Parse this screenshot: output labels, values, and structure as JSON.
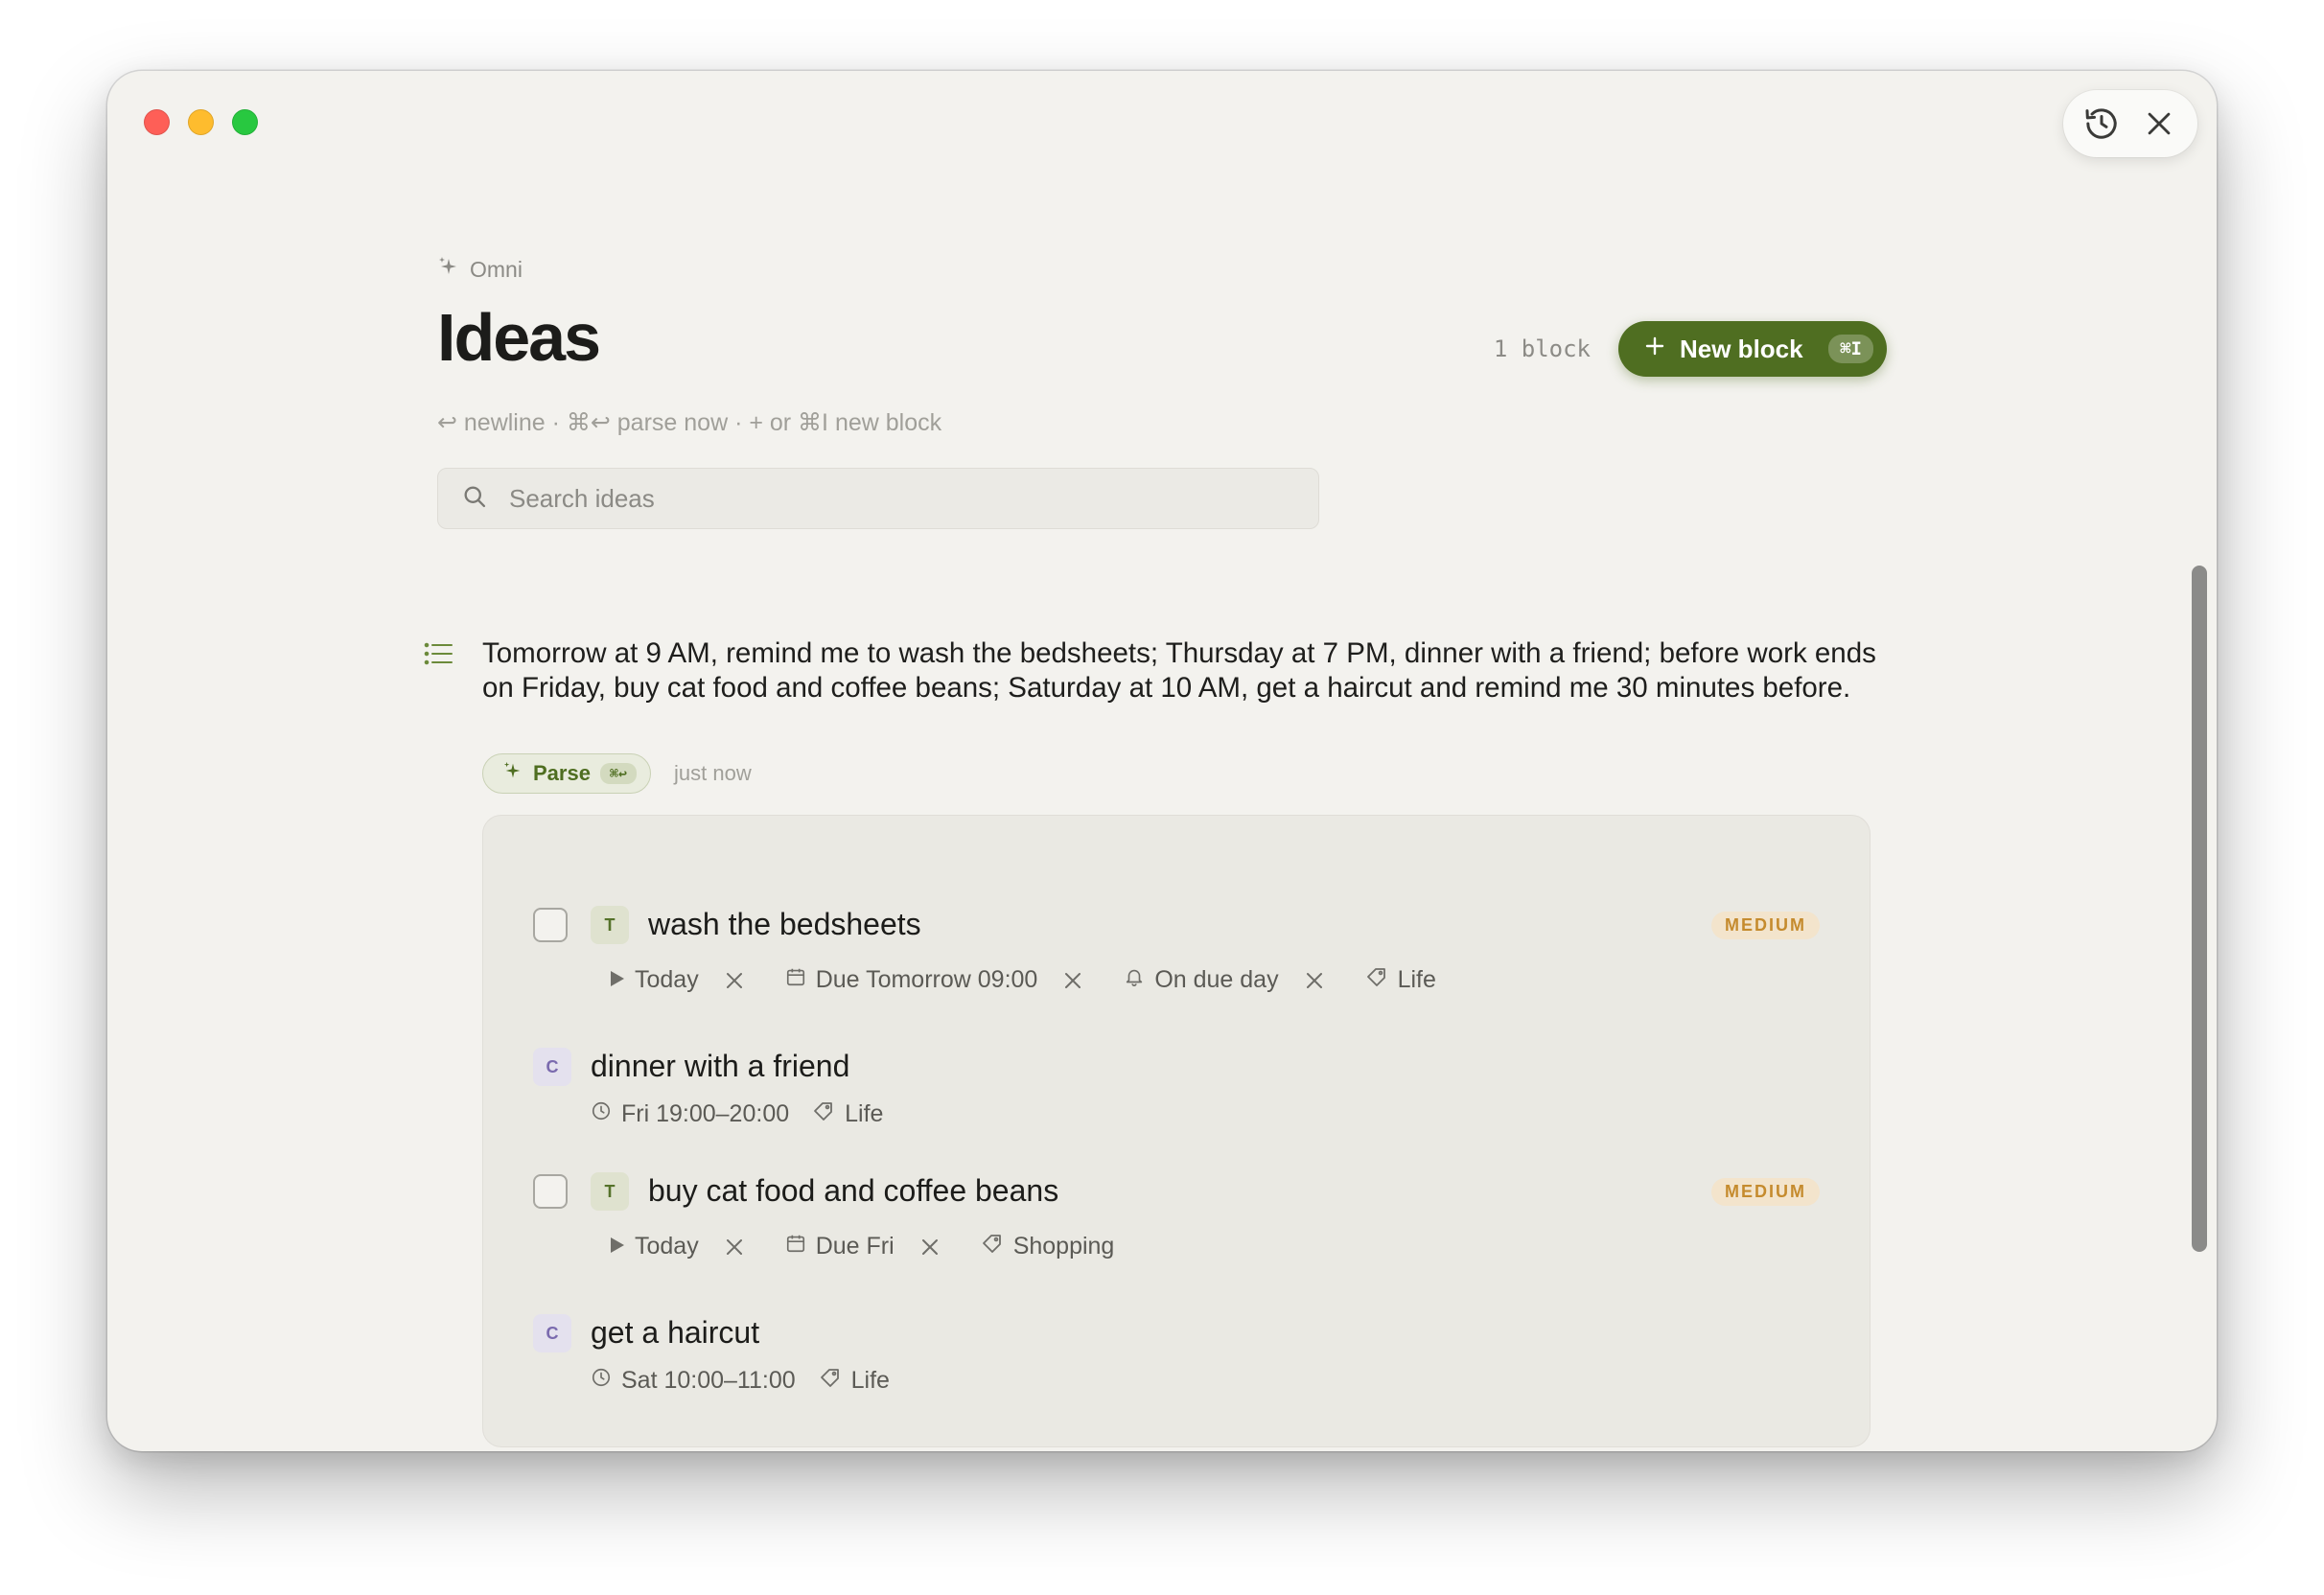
{
  "app": {
    "breadcrumb": "Omni",
    "title": "Ideas",
    "block_count": "1 block"
  },
  "toolbar": {
    "new_block_label": "New block",
    "new_block_shortcut": "⌘I"
  },
  "hint": {
    "text": "↩ newline · ⌘↩ parse now · + or ⌘I new block"
  },
  "search": {
    "placeholder": "Search ideas"
  },
  "block": {
    "text": "Tomorrow at 9 AM, remind me to wash the bedsheets; Thursday at 7 PM, dinner with a friend; before work ends on Friday, buy cat food and coffee beans; Saturday at 10 AM, get a haircut and remind me 30 minutes before.",
    "parse_label": "Parse",
    "parse_shortcut": "⌘↩",
    "timestamp": "just now"
  },
  "items": [
    {
      "type_badge": "T",
      "title": "wash the bedsheets",
      "priority": "MEDIUM",
      "start": "Today",
      "due": "Due Tomorrow 09:00",
      "reminder": "On due day",
      "tag": "Life"
    },
    {
      "type_badge": "C",
      "title": "dinner with a friend",
      "time": "Fri 19:00–20:00",
      "tag": "Life"
    },
    {
      "type_badge": "T",
      "title": "buy cat food and coffee beans",
      "priority": "MEDIUM",
      "start": "Today",
      "due": "Due Fri",
      "tag": "Shopping"
    },
    {
      "type_badge": "C",
      "title": "get a haircut",
      "time": "Sat 10:00–11:00",
      "tag": "Life"
    }
  ],
  "colors": {
    "accent": "#4f6e21",
    "background": "#f3f2ee",
    "priority_medium": "#c58b2e",
    "calendar_badge": "#7a6aae"
  },
  "icons": [
    "history-icon",
    "close-icon",
    "sparkle-icon",
    "search-icon",
    "list-icon",
    "play-icon",
    "calendar-icon",
    "bell-icon",
    "tag-icon",
    "clock-icon",
    "plus-icon"
  ]
}
